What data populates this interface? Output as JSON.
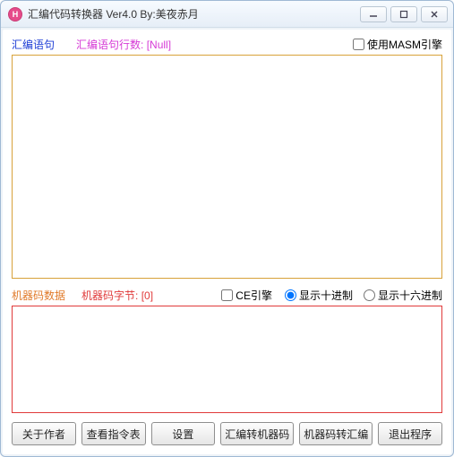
{
  "window": {
    "title": "汇编代码转换器 Ver4.0  By:美夜赤月"
  },
  "asm": {
    "label": "汇编语句",
    "lines_label": "汇编语句行数:",
    "lines_value": "[Null]",
    "use_masm_label": "使用MASM引擎",
    "use_masm_checked": false,
    "text": ""
  },
  "mc": {
    "label": "机器码数据",
    "bytes_label": "机器码字节:",
    "bytes_value": "[0]",
    "ce_engine_label": "CE引擎",
    "ce_engine_checked": false,
    "radix_dec_label": "显示十进制",
    "radix_hex_label": "显示十六进制",
    "radix_selected": "dec",
    "text": ""
  },
  "buttons": {
    "about": "关于作者",
    "opcodes": "查看指令表",
    "settings": "设置",
    "asm_to_mc": "汇编转机器码",
    "mc_to_asm": "机器码转汇编",
    "exit": "退出程序"
  }
}
